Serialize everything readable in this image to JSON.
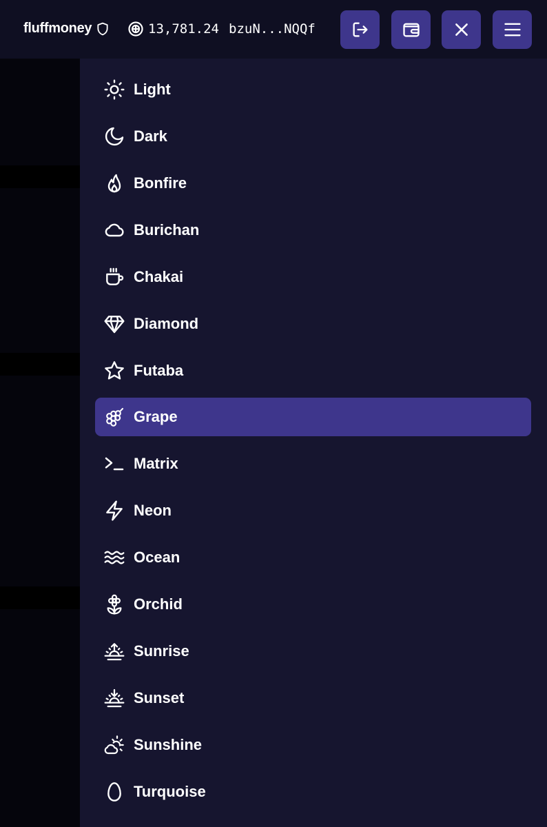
{
  "header": {
    "username": "fluffmoney",
    "balance": "13,781.24",
    "address": "bzuN...NQQf",
    "buttons": [
      {
        "icon": "logout-icon"
      },
      {
        "icon": "wallet-icon"
      },
      {
        "icon": "close-icon"
      },
      {
        "icon": "hamburger-menu-icon"
      }
    ]
  },
  "theme_menu": {
    "selected": "Grape",
    "items": [
      {
        "label": "Light",
        "icon": "sun-icon"
      },
      {
        "label": "Dark",
        "icon": "moon-icon"
      },
      {
        "label": "Bonfire",
        "icon": "flame-icon"
      },
      {
        "label": "Burichan",
        "icon": "cloud-icon"
      },
      {
        "label": "Chakai",
        "icon": "tea-cup-icon"
      },
      {
        "label": "Diamond",
        "icon": "diamond-icon"
      },
      {
        "label": "Futaba",
        "icon": "star-icon"
      },
      {
        "label": "Grape",
        "icon": "grape-icon"
      },
      {
        "label": "Matrix",
        "icon": "terminal-icon"
      },
      {
        "label": "Neon",
        "icon": "lightning-icon"
      },
      {
        "label": "Ocean",
        "icon": "waves-icon"
      },
      {
        "label": "Orchid",
        "icon": "flower-icon"
      },
      {
        "label": "Sunrise",
        "icon": "sunrise-icon"
      },
      {
        "label": "Sunset",
        "icon": "sunset-icon"
      },
      {
        "label": "Sunshine",
        "icon": "sun-cloud-icon"
      },
      {
        "label": "Turquoise",
        "icon": "egg-icon"
      }
    ]
  },
  "colors": {
    "topbar_bg": "#0f0f22",
    "menu_bg": "#16152f",
    "accent": "#3e368c",
    "page_bg": "#05050c"
  }
}
